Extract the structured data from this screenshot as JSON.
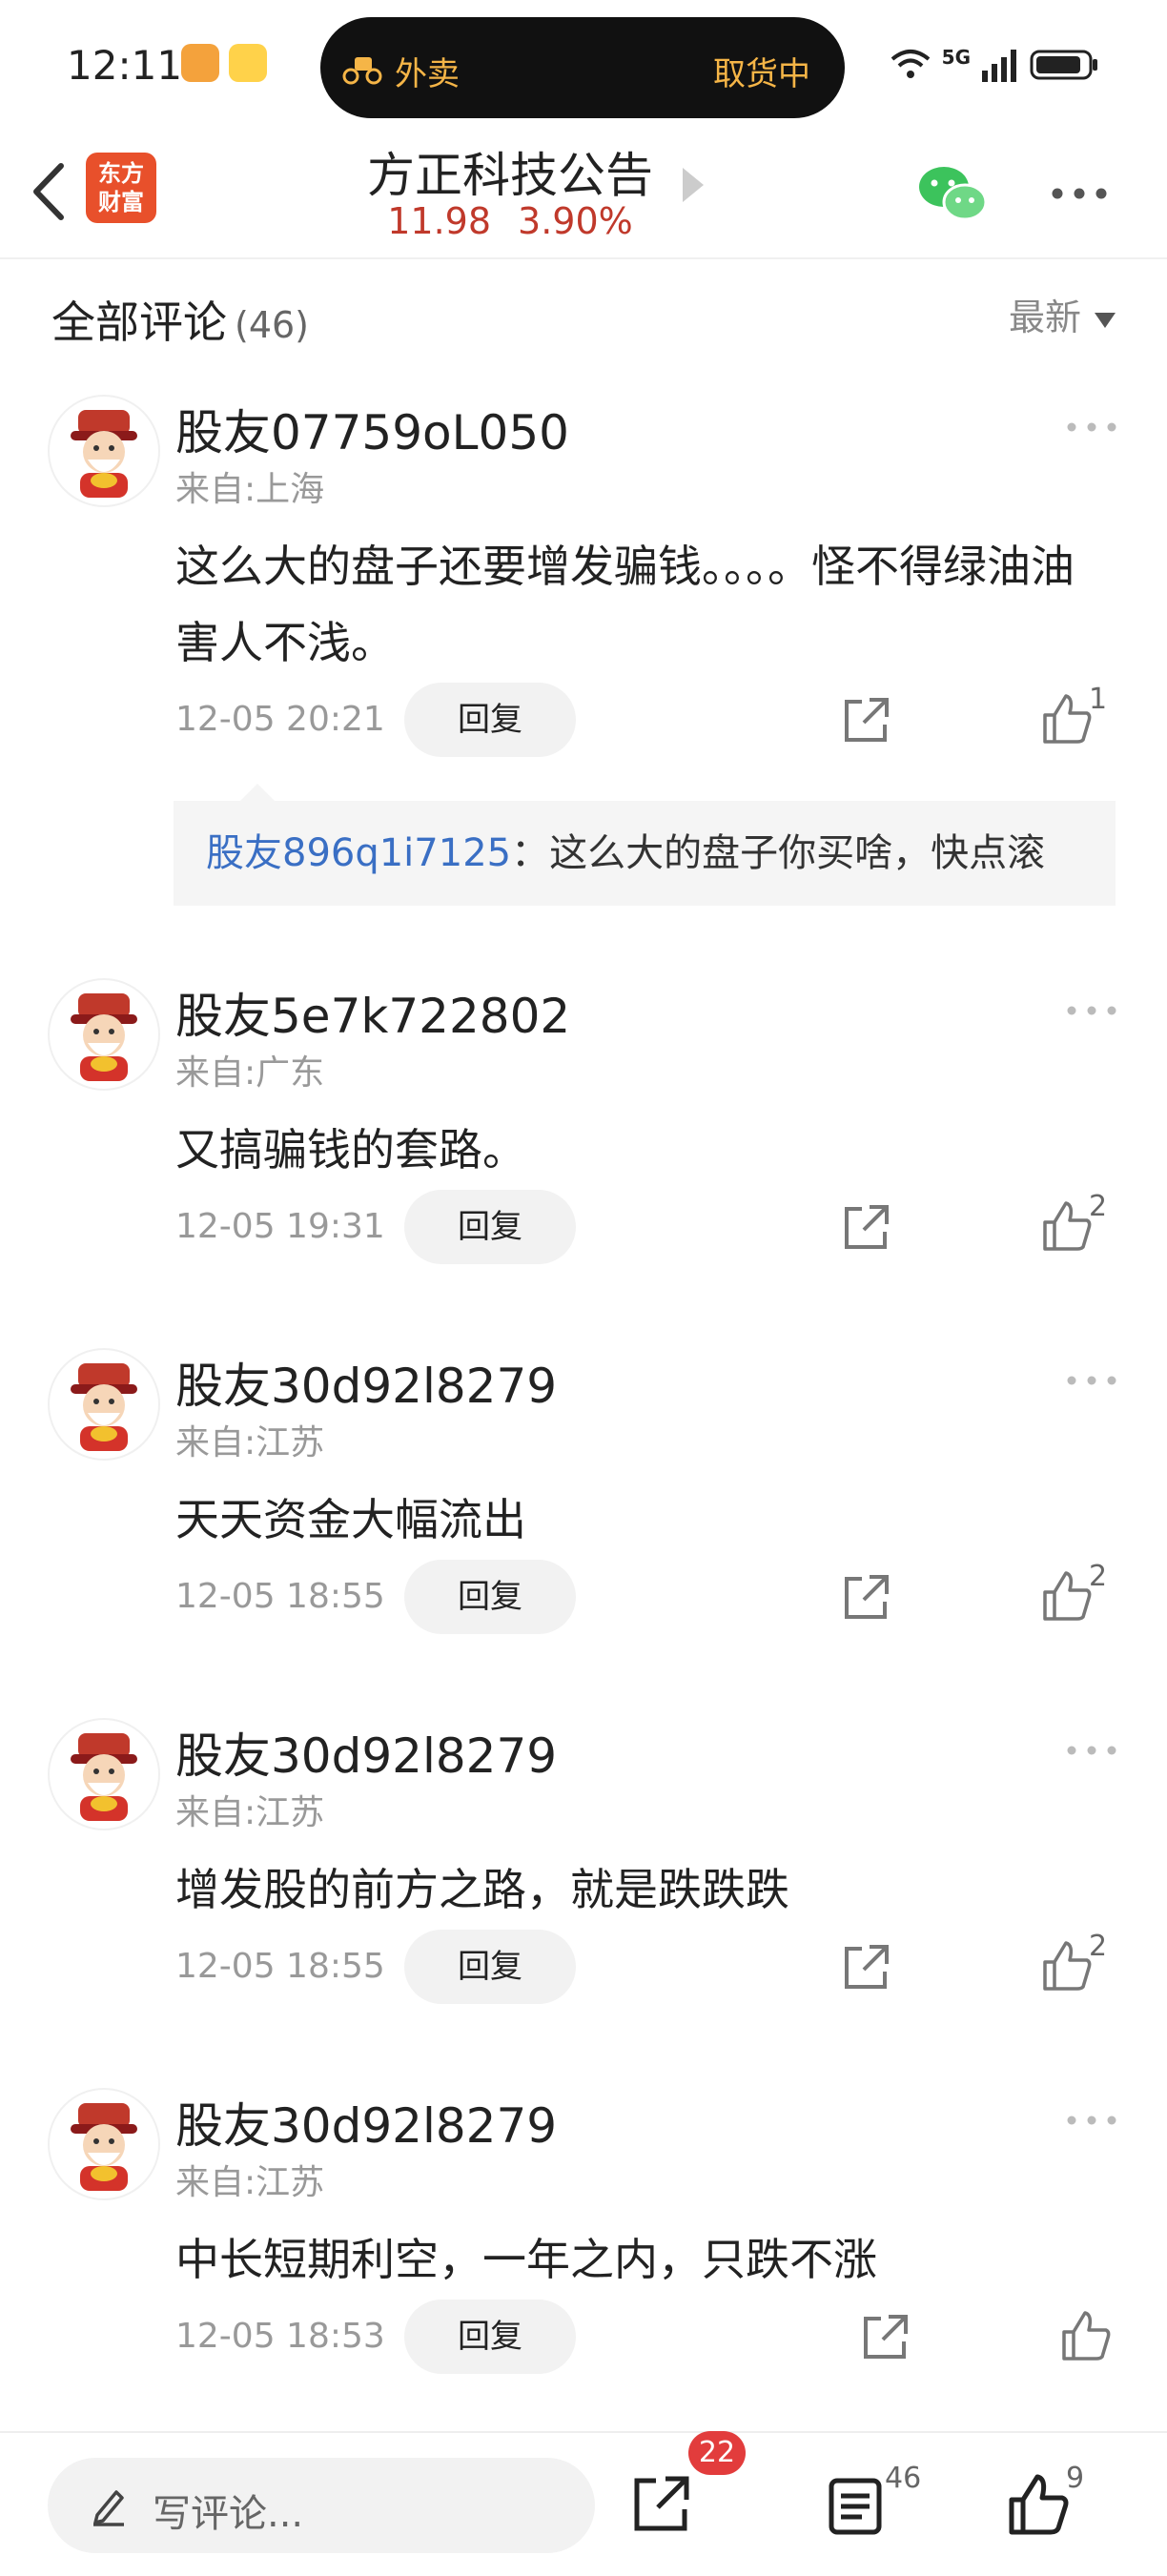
{
  "status_bar": {
    "time": "12:11",
    "island_left": "外卖",
    "island_right": "取货中",
    "network": "5G"
  },
  "header": {
    "logo_line1": "东方",
    "logo_line2": "财富",
    "title": "方正科技公告",
    "price": "11.98",
    "change": "3.90%"
  },
  "comments_section": {
    "title": "全部评论",
    "count": "(46)",
    "sort_label": "最新"
  },
  "reply_label": "回复",
  "comments": [
    {
      "user": "股友07759oL050",
      "from": "来自:上海",
      "text": "这么大的盘子还要增发骗钱。。。。怪不得绿油油害人不浅。",
      "time": "12-05 20:21",
      "likes": "1",
      "sub_reply": {
        "user": "股友896q1i7125",
        "text": "：这么大的盘子你买啥，快点滚"
      }
    },
    {
      "user": "股友5e7k722802",
      "from": "来自:广东",
      "text": "又搞骗钱的套路。",
      "time": "12-05 19:31",
      "likes": "2"
    },
    {
      "user": "股友30d92l8279",
      "from": "来自:江苏",
      "text": "天天资金大幅流出",
      "time": "12-05 18:55",
      "likes": "2"
    },
    {
      "user": "股友30d92l8279",
      "from": "来自:江苏",
      "text": "增发股的前方之路，就是跌跌跌",
      "time": "12-05 18:55",
      "likes": "2"
    },
    {
      "user": "股友30d92l8279",
      "from": "来自:江苏",
      "text": "中长短期利空，一年之内，只跌不涨",
      "time": "12-05 18:53",
      "likes": ""
    }
  ],
  "bottom_bar": {
    "placeholder": "写评论...",
    "share_badge": "22",
    "comment_count": "46",
    "like_count": "9"
  },
  "colors": {
    "price_red": "#c0392b",
    "reply_user_blue": "#3a6fc4",
    "badge_red": "#e23c3c",
    "island_orange": "#f5b547",
    "logo_orange": "#e8502b"
  }
}
